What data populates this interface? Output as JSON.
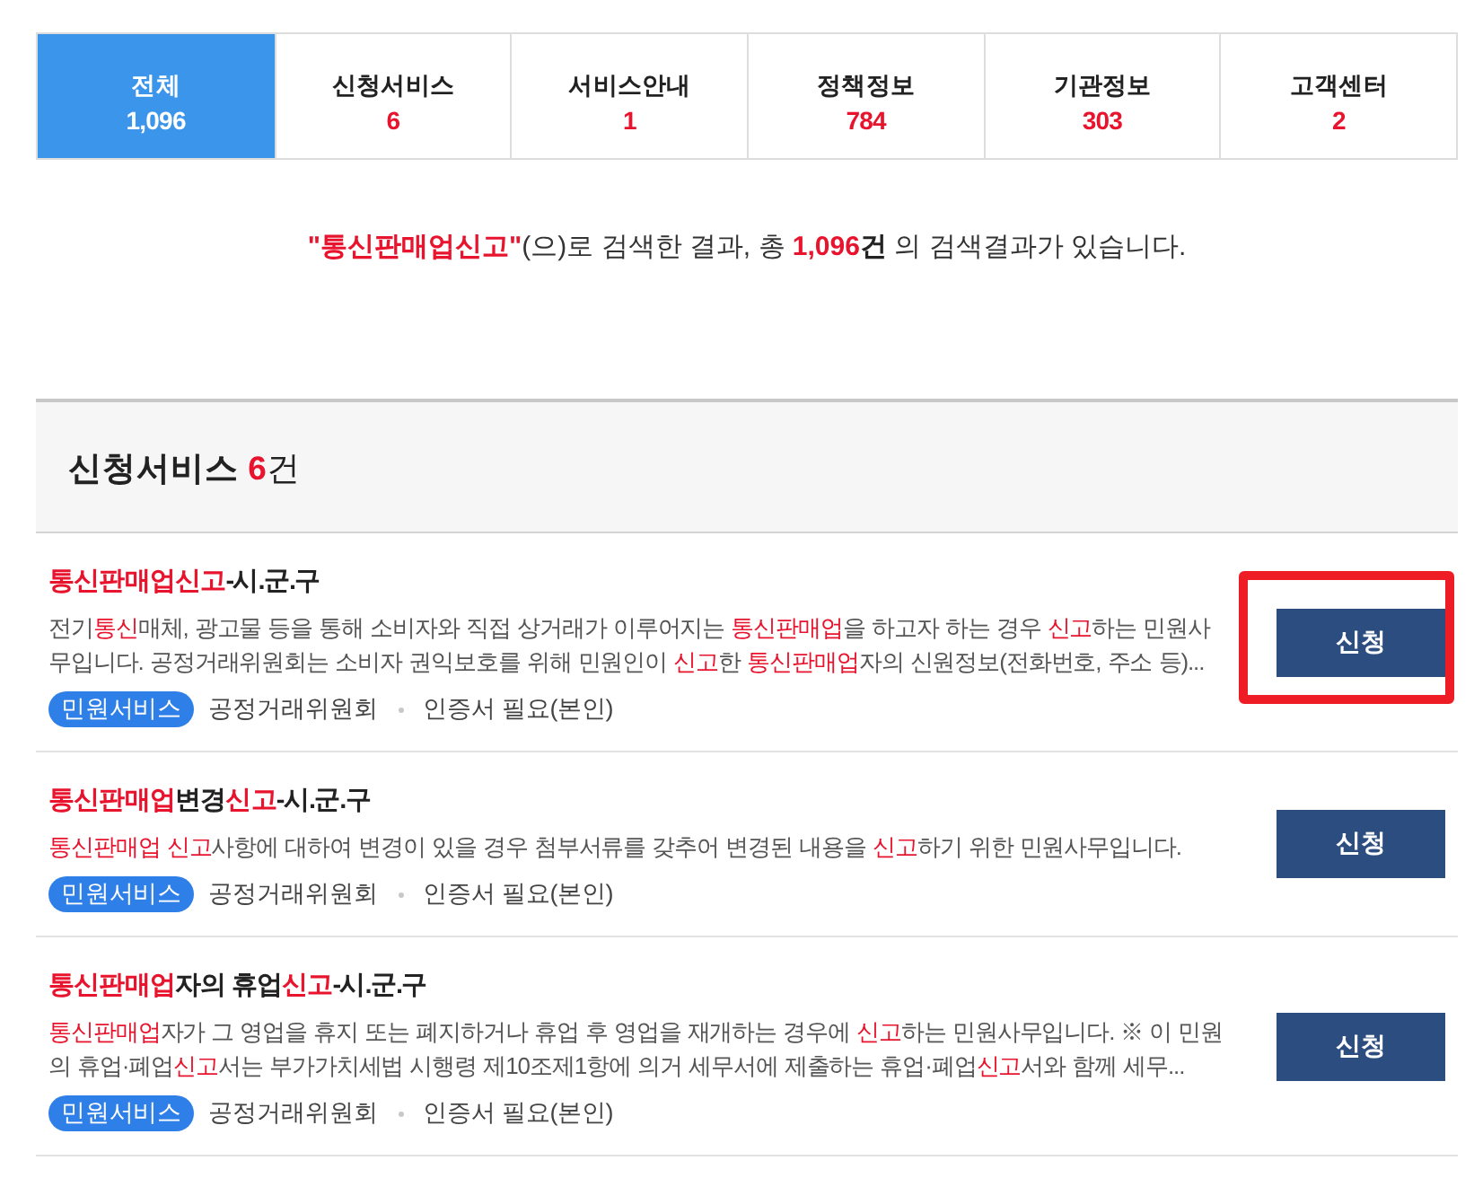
{
  "tabs": [
    {
      "label": "전체",
      "count": "1,096",
      "selected": true
    },
    {
      "label": "신청서비스",
      "count": "6",
      "selected": false
    },
    {
      "label": "서비스안내",
      "count": "1",
      "selected": false
    },
    {
      "label": "정책정보",
      "count": "784",
      "selected": false
    },
    {
      "label": "기관정보",
      "count": "303",
      "selected": false
    },
    {
      "label": "고객센터",
      "count": "2",
      "selected": false
    }
  ],
  "summary": {
    "keyword": "\"통신판매업신고\"",
    "text_before_count": "(으)로 검색한 결과, 총 ",
    "count": "1,096",
    "unit": "건",
    "text_after": " 의 검색결과가 있습니다."
  },
  "section": {
    "title": "신청서비스",
    "count": "6",
    "unit": "건"
  },
  "results": [
    {
      "title": [
        {
          "text": "통신판매업신고",
          "highlight": true
        },
        {
          "text": "-시.군.구",
          "highlight": false
        }
      ],
      "description": [
        {
          "text": "전기",
          "highlight": false
        },
        {
          "text": "통신",
          "highlight": true
        },
        {
          "text": "매체, 광고물 등을 통해 소비자와 직접 상거래가 이루어지는 ",
          "highlight": false
        },
        {
          "text": "통신판매업",
          "highlight": true
        },
        {
          "text": "을 하고자 하는 경우 ",
          "highlight": false
        },
        {
          "text": "신고",
          "highlight": true
        },
        {
          "text": "하는 민원사무입니다. 공정거래위원회는 소비자 권익보호를 위해 민원인이 ",
          "highlight": false
        },
        {
          "text": "신고",
          "highlight": true
        },
        {
          "text": "한 ",
          "highlight": false
        },
        {
          "text": "통신판매업",
          "highlight": true
        },
        {
          "text": "자의 신원정보(전화번호, 주소 등)...",
          "highlight": false
        }
      ],
      "tag": "민원서비스",
      "agency": "공정거래위원회",
      "requirement": "인증서 필요(본인)",
      "button": "신청",
      "highlighted": true
    },
    {
      "title": [
        {
          "text": "통신판매업",
          "highlight": true
        },
        {
          "text": "변경",
          "highlight": false
        },
        {
          "text": "신고",
          "highlight": true
        },
        {
          "text": "-시.군.구",
          "highlight": false
        }
      ],
      "description": [
        {
          "text": "통신판매업 ",
          "highlight": true
        },
        {
          "text": "신고",
          "highlight": true
        },
        {
          "text": "사항에 대하여 변경이 있을 경우 첨부서류를 갖추어 변경된 내용을 ",
          "highlight": false
        },
        {
          "text": "신고",
          "highlight": true
        },
        {
          "text": "하기 위한 민원사무입니다.",
          "highlight": false
        }
      ],
      "tag": "민원서비스",
      "agency": "공정거래위원회",
      "requirement": "인증서 필요(본인)",
      "button": "신청",
      "highlighted": false
    },
    {
      "title": [
        {
          "text": "통신판매업",
          "highlight": true
        },
        {
          "text": "자의 휴업",
          "highlight": false
        },
        {
          "text": "신고",
          "highlight": true
        },
        {
          "text": "-시.군.구",
          "highlight": false
        }
      ],
      "description": [
        {
          "text": "통신판매업",
          "highlight": true
        },
        {
          "text": "자가 그 영업을 휴지 또는 폐지하거나 휴업 후 영업을 재개하는 경우에 ",
          "highlight": false
        },
        {
          "text": "신고",
          "highlight": true
        },
        {
          "text": "하는 민원사무입니다. ※ 이 민원의 휴업·폐업",
          "highlight": false
        },
        {
          "text": "신고",
          "highlight": true
        },
        {
          "text": "서는 부가가치세법 시행령 제10조제1항에 의거 세무서에 제출하는 휴업·폐업",
          "highlight": false
        },
        {
          "text": "신고",
          "highlight": true
        },
        {
          "text": "서와 함께 세무...",
          "highlight": false
        }
      ],
      "tag": "민원서비스",
      "agency": "공정거래위원회",
      "requirement": "인증서 필요(본인)",
      "button": "신청",
      "highlighted": false
    }
  ]
}
